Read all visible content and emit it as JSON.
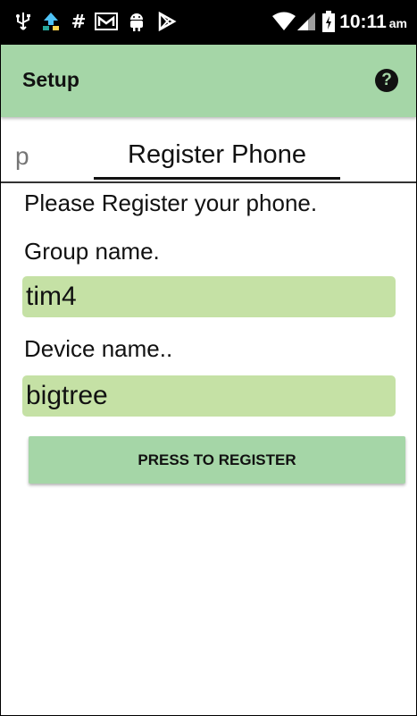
{
  "status_bar": {
    "icons": [
      "usb-icon",
      "upload-sync-icon",
      "hash-icon",
      "gmail-icon",
      "android-debug-icon",
      "play-store-icon",
      "wifi-icon",
      "signal-icon",
      "battery-icon"
    ],
    "time": "10:11",
    "ampm": "am",
    "bg_color": "#000000"
  },
  "app_bar": {
    "title": "Setup",
    "help_icon": "?",
    "bg_color": "#a5d6a7"
  },
  "tabs": {
    "previous_label": "p",
    "current_label": "Register Phone"
  },
  "form": {
    "instruction": "Please Register your phone.",
    "group_label": "Group name.",
    "group_value": "tim4",
    "device_label": "Device name..",
    "device_value": "bigtree",
    "field_color": "#c5e1a5",
    "register_label": "PRESS TO REGISTER",
    "button_color": "#a5d6a7"
  }
}
